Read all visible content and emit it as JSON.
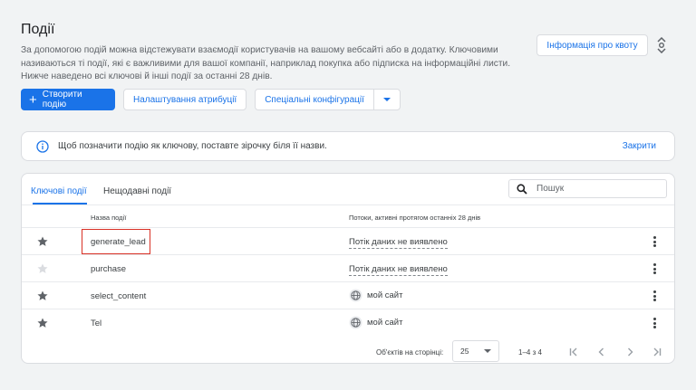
{
  "page": {
    "title": "Події",
    "description": "За допомогою подій можна відстежувати взаємодії користувачів на вашому вебсайті або в додатку. Ключовими називаються ті події, які є важливими для вашої компанії, наприклад покупка або підписка на інформаційні листи. Нижче наведено всі ключові й інші події за останні 28 днів."
  },
  "header": {
    "quota_button": "Інформація про квоту",
    "quota_icon": "expand-vertical-icon"
  },
  "toolbar": {
    "create_label": "Створити подію",
    "attribution_label": "Налаштування атрибуції",
    "special_label": "Спеціальні конфігурації"
  },
  "banner": {
    "text": "Щоб позначити подію як ключову, поставте зірочку біля її назви.",
    "close_label": "Закрити"
  },
  "tabs": [
    {
      "label": "Ключові події"
    },
    {
      "label": "Нещодавні події"
    }
  ],
  "search": {
    "placeholder": "Пошук"
  },
  "table": {
    "columns": {
      "name": "Назва події",
      "streams": "Потоки, активні протягом останніх 28 днів"
    },
    "rows": [
      {
        "name": "generate_lead",
        "starred": true,
        "stream": "Потік даних не виявлено",
        "stream_type": "none"
      },
      {
        "name": "purchase",
        "starred": false,
        "stream": "Потік даних не виявлено",
        "stream_type": "none"
      },
      {
        "name": "select_content",
        "starred": true,
        "stream": "мой сайт",
        "stream_type": "site"
      },
      {
        "name": "Tel",
        "starred": true,
        "stream": "мой сайт",
        "stream_type": "site"
      }
    ]
  },
  "pagination": {
    "per_page_label": "Об'єктів на сторінці:",
    "per_page_value": "25",
    "range": "1–4 з 4"
  },
  "colors": {
    "accent": "#1a73e8",
    "star_on": "#5f6368",
    "star_off": "#dadce0",
    "highlight": "#d93025"
  }
}
